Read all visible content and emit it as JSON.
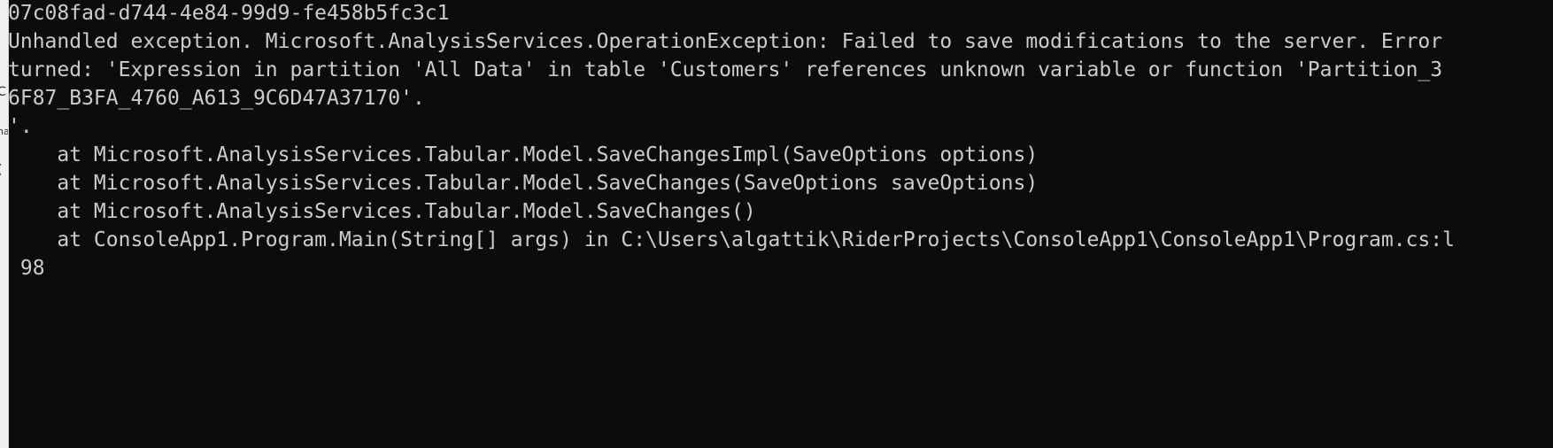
{
  "console": {
    "lines": [
      "07c08fad-d744-4e84-99d9-fe458b5fc3c1",
      "Unhandled exception. Microsoft.AnalysisServices.OperationException: Failed to save modifications to the server. Error",
      "turned: 'Expression in partition 'All Data' in table 'Customers' references unknown variable or function 'Partition_3",
      "6F87_B3FA_4760_A613_9C6D47A37170'.",
      "'.",
      "    at Microsoft.AnalysisServices.Tabular.Model.SaveChangesImpl(SaveOptions options)",
      "    at Microsoft.AnalysisServices.Tabular.Model.SaveChanges(SaveOptions saveOptions)",
      "    at Microsoft.AnalysisServices.Tabular.Model.SaveChanges()",
      "    at ConsoleApp1.Program.Main(String[] args) in C:\\Users\\algattik\\RiderProjects\\ConsoleApp1\\ConsoleApp1\\Program.cs:l",
      " 98"
    ]
  },
  "left_strip": {
    "glyph_1": "C",
    "glyph_2": "na",
    "glyph_3": "("
  },
  "colors": {
    "background": "#0c0c0c",
    "text": "#cccccc",
    "left_strip": "#f0f0f0"
  }
}
